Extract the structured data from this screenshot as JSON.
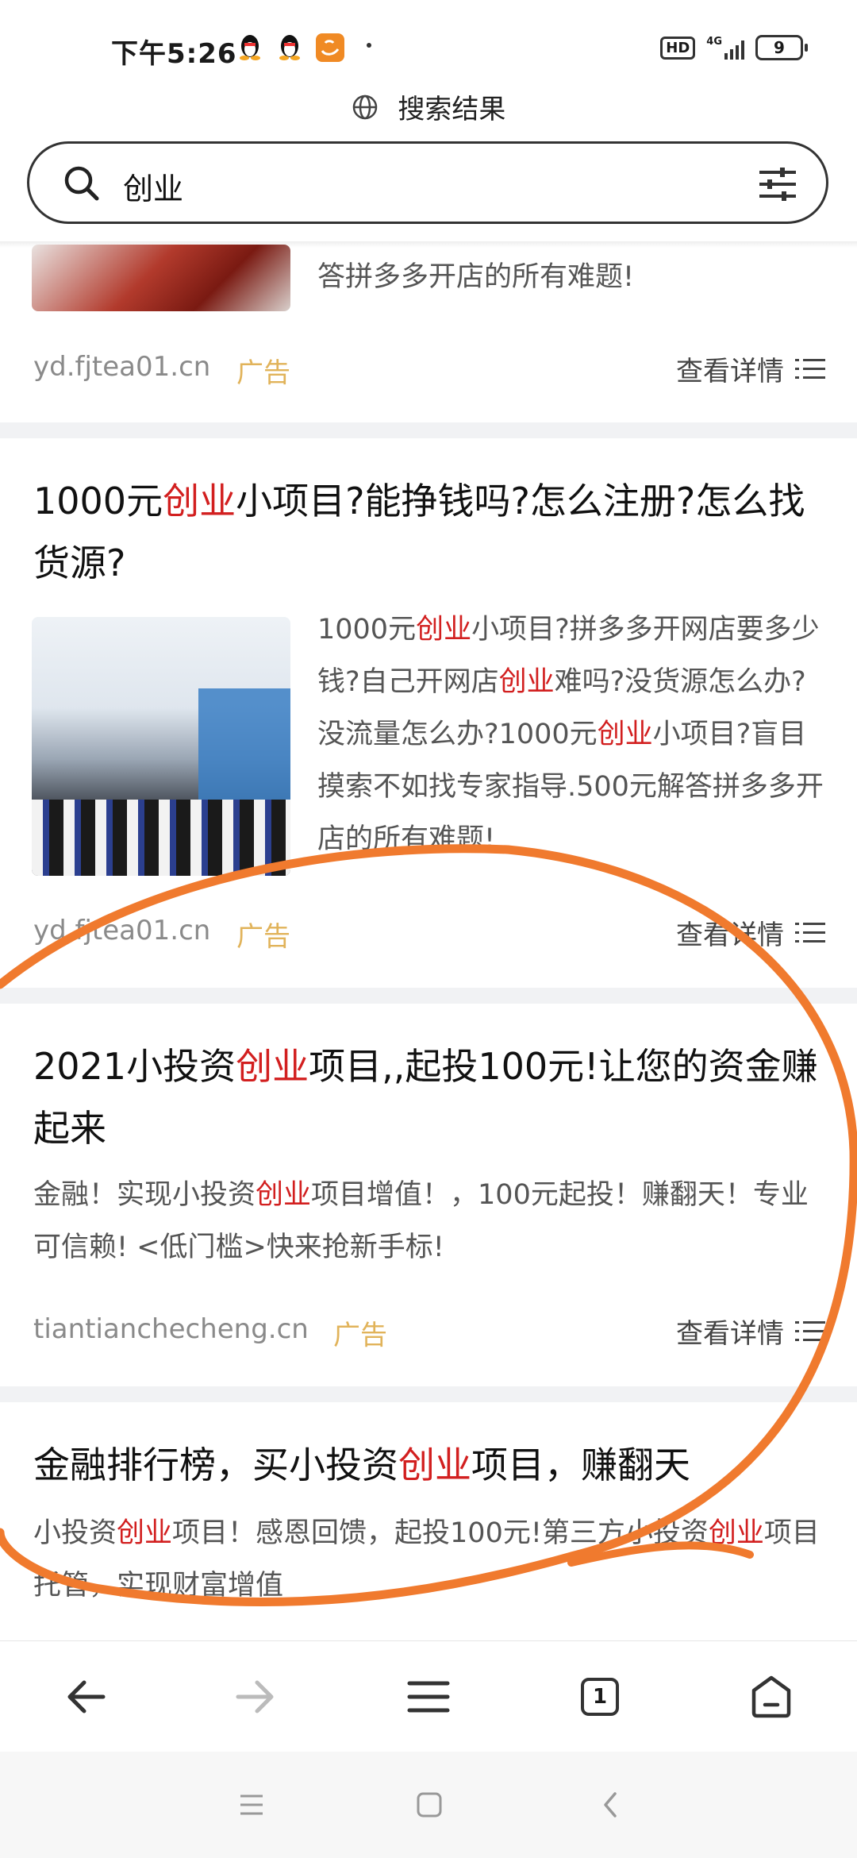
{
  "status": {
    "time": "下午5:26",
    "hd": "HD",
    "network": "4G",
    "battery": "9"
  },
  "header": {
    "title": "搜索结果"
  },
  "search": {
    "query": "创业"
  },
  "results": [
    {
      "desc_tail": "答拼多多开店的所有难题!",
      "url": "yd.fjtea01.cn",
      "ad": "广告",
      "detail": "查看详情"
    },
    {
      "title_pre": "1000元",
      "title_hl": "创业",
      "title_post": "小项目?能挣钱吗?怎么注册?怎么找货源?",
      "desc_p1": "1000元",
      "desc_h1": "创业",
      "desc_p2": "小项目?拼多多开网店要多少钱?自己开网店",
      "desc_h2": "创业",
      "desc_p3": "难吗?没货源怎么办?没流量怎么办?1000元",
      "desc_h3": "创业",
      "desc_p4": "小项目?盲目摸索不如找专家指导.500元解答拼多多开店的所有难题!",
      "url": "yd.fjtea01.cn",
      "ad": "广告",
      "detail": "查看详情"
    },
    {
      "title_pre": "2021小投资",
      "title_hl": "创业",
      "title_post": "项目,,起投100元!让您的资金赚起来",
      "desc_p1": "金融！实现小投资",
      "desc_h1": "创业",
      "desc_p2": "项目增值！，100元起投！赚翻天！专业可信赖! <低门槛>快来抢新手标!",
      "url": "tiantianchecheng.cn",
      "ad": "广告",
      "detail": "查看详情"
    },
    {
      "title_pre": "金融排行榜，买小投资",
      "title_hl": "创业",
      "title_post": "项目，赚翻天",
      "desc_p1": "小投资",
      "desc_h1": "创业",
      "desc_p2": "项目！感恩回馈，起投100元!第三方小投资",
      "desc_h2": "创业",
      "desc_p3": "项目托管，实现财富增值"
    }
  ],
  "toolbar": {
    "tab_count": "1"
  },
  "colors": {
    "highlight": "#d21f1f",
    "ad": "#e1b35a",
    "annotation": "#f07a2e"
  }
}
